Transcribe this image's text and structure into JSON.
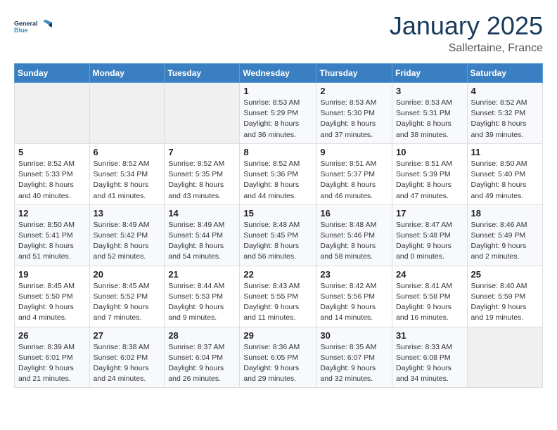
{
  "header": {
    "logo_line1": "General",
    "logo_line2": "Blue",
    "month": "January 2025",
    "location": "Sallertaine, France"
  },
  "days_of_week": [
    "Sunday",
    "Monday",
    "Tuesday",
    "Wednesday",
    "Thursday",
    "Friday",
    "Saturday"
  ],
  "weeks": [
    [
      {
        "day": "",
        "info": ""
      },
      {
        "day": "",
        "info": ""
      },
      {
        "day": "",
        "info": ""
      },
      {
        "day": "1",
        "info": "Sunrise: 8:53 AM\nSunset: 5:29 PM\nDaylight: 8 hours and 36 minutes."
      },
      {
        "day": "2",
        "info": "Sunrise: 8:53 AM\nSunset: 5:30 PM\nDaylight: 8 hours and 37 minutes."
      },
      {
        "day": "3",
        "info": "Sunrise: 8:53 AM\nSunset: 5:31 PM\nDaylight: 8 hours and 38 minutes."
      },
      {
        "day": "4",
        "info": "Sunrise: 8:52 AM\nSunset: 5:32 PM\nDaylight: 8 hours and 39 minutes."
      }
    ],
    [
      {
        "day": "5",
        "info": "Sunrise: 8:52 AM\nSunset: 5:33 PM\nDaylight: 8 hours and 40 minutes."
      },
      {
        "day": "6",
        "info": "Sunrise: 8:52 AM\nSunset: 5:34 PM\nDaylight: 8 hours and 41 minutes."
      },
      {
        "day": "7",
        "info": "Sunrise: 8:52 AM\nSunset: 5:35 PM\nDaylight: 8 hours and 43 minutes."
      },
      {
        "day": "8",
        "info": "Sunrise: 8:52 AM\nSunset: 5:36 PM\nDaylight: 8 hours and 44 minutes."
      },
      {
        "day": "9",
        "info": "Sunrise: 8:51 AM\nSunset: 5:37 PM\nDaylight: 8 hours and 46 minutes."
      },
      {
        "day": "10",
        "info": "Sunrise: 8:51 AM\nSunset: 5:39 PM\nDaylight: 8 hours and 47 minutes."
      },
      {
        "day": "11",
        "info": "Sunrise: 8:50 AM\nSunset: 5:40 PM\nDaylight: 8 hours and 49 minutes."
      }
    ],
    [
      {
        "day": "12",
        "info": "Sunrise: 8:50 AM\nSunset: 5:41 PM\nDaylight: 8 hours and 51 minutes."
      },
      {
        "day": "13",
        "info": "Sunrise: 8:49 AM\nSunset: 5:42 PM\nDaylight: 8 hours and 52 minutes."
      },
      {
        "day": "14",
        "info": "Sunrise: 8:49 AM\nSunset: 5:44 PM\nDaylight: 8 hours and 54 minutes."
      },
      {
        "day": "15",
        "info": "Sunrise: 8:48 AM\nSunset: 5:45 PM\nDaylight: 8 hours and 56 minutes."
      },
      {
        "day": "16",
        "info": "Sunrise: 8:48 AM\nSunset: 5:46 PM\nDaylight: 8 hours and 58 minutes."
      },
      {
        "day": "17",
        "info": "Sunrise: 8:47 AM\nSunset: 5:48 PM\nDaylight: 9 hours and 0 minutes."
      },
      {
        "day": "18",
        "info": "Sunrise: 8:46 AM\nSunset: 5:49 PM\nDaylight: 9 hours and 2 minutes."
      }
    ],
    [
      {
        "day": "19",
        "info": "Sunrise: 8:45 AM\nSunset: 5:50 PM\nDaylight: 9 hours and 4 minutes."
      },
      {
        "day": "20",
        "info": "Sunrise: 8:45 AM\nSunset: 5:52 PM\nDaylight: 9 hours and 7 minutes."
      },
      {
        "day": "21",
        "info": "Sunrise: 8:44 AM\nSunset: 5:53 PM\nDaylight: 9 hours and 9 minutes."
      },
      {
        "day": "22",
        "info": "Sunrise: 8:43 AM\nSunset: 5:55 PM\nDaylight: 9 hours and 11 minutes."
      },
      {
        "day": "23",
        "info": "Sunrise: 8:42 AM\nSunset: 5:56 PM\nDaylight: 9 hours and 14 minutes."
      },
      {
        "day": "24",
        "info": "Sunrise: 8:41 AM\nSunset: 5:58 PM\nDaylight: 9 hours and 16 minutes."
      },
      {
        "day": "25",
        "info": "Sunrise: 8:40 AM\nSunset: 5:59 PM\nDaylight: 9 hours and 19 minutes."
      }
    ],
    [
      {
        "day": "26",
        "info": "Sunrise: 8:39 AM\nSunset: 6:01 PM\nDaylight: 9 hours and 21 minutes."
      },
      {
        "day": "27",
        "info": "Sunrise: 8:38 AM\nSunset: 6:02 PM\nDaylight: 9 hours and 24 minutes."
      },
      {
        "day": "28",
        "info": "Sunrise: 8:37 AM\nSunset: 6:04 PM\nDaylight: 9 hours and 26 minutes."
      },
      {
        "day": "29",
        "info": "Sunrise: 8:36 AM\nSunset: 6:05 PM\nDaylight: 9 hours and 29 minutes."
      },
      {
        "day": "30",
        "info": "Sunrise: 8:35 AM\nSunset: 6:07 PM\nDaylight: 9 hours and 32 minutes."
      },
      {
        "day": "31",
        "info": "Sunrise: 8:33 AM\nSunset: 6:08 PM\nDaylight: 9 hours and 34 minutes."
      },
      {
        "day": "",
        "info": ""
      }
    ]
  ]
}
